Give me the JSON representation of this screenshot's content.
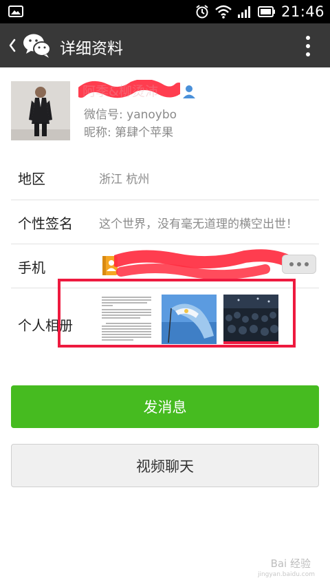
{
  "status_bar": {
    "time": "21:46"
  },
  "header": {
    "title": "详细资料"
  },
  "profile": {
    "name": "阿季&柳烫沛",
    "wechat_id": "微信号: yanoybo",
    "nickname": "昵称: 第肆个苹果"
  },
  "rows": {
    "region_label": "地区",
    "region_value": "浙江  杭州",
    "signature_label": "个性签名",
    "signature_value": "这个世界，没有毫无道理的横空出世！",
    "phone_label": "手机",
    "album_label": "个人相册"
  },
  "buttons": {
    "send_message": "发消息",
    "video_chat": "视频聊天"
  },
  "watermark": {
    "text": "Bai 经验",
    "sub": "jingyan.baidu.com"
  },
  "colors": {
    "accent_green": "#46bb20",
    "highlight_red": "#ee1a3f",
    "toolbar": "#383838"
  }
}
